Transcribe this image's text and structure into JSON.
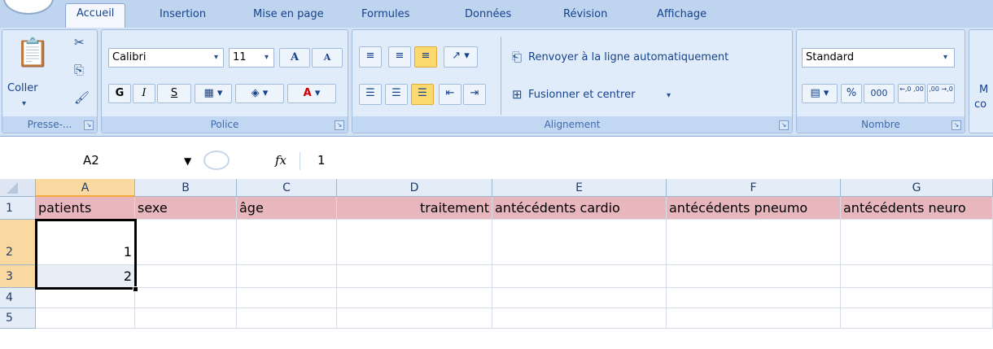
{
  "tabs": [
    "Accueil",
    "Insertion",
    "Mise en page",
    "Formules",
    "Données",
    "Révision",
    "Affichage"
  ],
  "clipboard": {
    "paste_label": "Coller",
    "group_label": "Presse-..."
  },
  "font": {
    "name": "Calibri",
    "size": "11",
    "grow": "A",
    "shrink": "A",
    "bold": "G",
    "italic": "I",
    "underline": "S",
    "fill_glyph": "⛫",
    "color_glyph": "A",
    "group_label": "Police"
  },
  "alignment": {
    "wrap_label": "Renvoyer à la ligne automatiquement",
    "merge_label": "Fusionner et centrer",
    "group_label": "Alignement"
  },
  "number": {
    "format": "Standard",
    "percent": "%",
    "thousands": "000",
    "inc_decimal": "←,0 ,00",
    "dec_decimal": ",00 →,0",
    "group_label": "Nombre"
  },
  "partial_group": {
    "line1": "M",
    "line2": "co"
  },
  "formula_bar": {
    "name_box": "A2",
    "fx": "fx",
    "value": "1"
  },
  "columns": [
    "A",
    "B",
    "C",
    "D",
    "E",
    "F",
    "G"
  ],
  "rows": [
    "1",
    "2",
    "3",
    "4",
    "5"
  ],
  "cells": {
    "A1": "patients",
    "B1": "sexe",
    "C1": "âge",
    "D1": "traitement",
    "E1": "antécédents cardio",
    "F1": "antécédents pneumo",
    "G1": "antécédents neuro",
    "A2": "1",
    "A3": "2"
  },
  "colors": {
    "header_row": "#e8b7bd",
    "selection_border": "#000000",
    "ribbon": "#d3e2f5",
    "highlight": "#fdd86c"
  }
}
